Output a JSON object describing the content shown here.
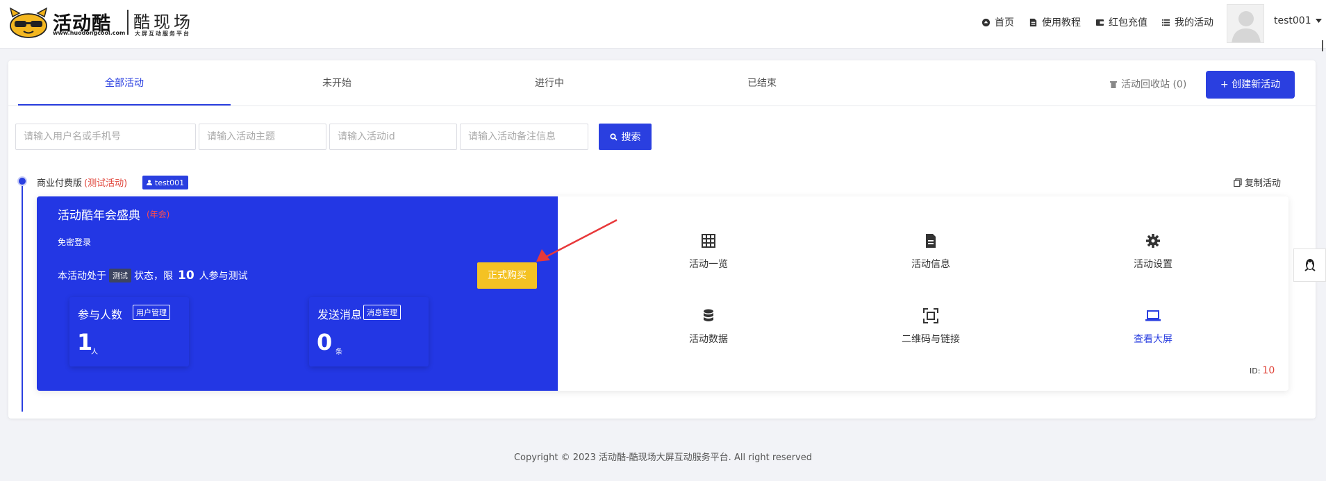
{
  "brand": {
    "name": "活动酷",
    "url": "www.huodongcool.com",
    "sub_title": "酷现场",
    "sub_en": "大屏互动服务平台"
  },
  "nav": {
    "home": "首页",
    "tutorial": "使用教程",
    "recharge": "红包充值",
    "my_activity": "我的活动",
    "username": "test001"
  },
  "tabs": [
    "全部活动",
    "未开始",
    "进行中",
    "已结束"
  ],
  "recycle_bin": "活动回收站 (0)",
  "create_button": "+ 创建新活动",
  "search": {
    "user_placeholder": "请输入用户名或手机号",
    "theme_placeholder": "请输入活动主题",
    "id_placeholder": "请输入活动id",
    "note_placeholder": "请输入活动备注信息",
    "button": "搜索"
  },
  "edition": {
    "label": "商业付费版",
    "test_tag": "(测试活动)",
    "user": "test001",
    "copy": "复制活动"
  },
  "activity": {
    "title": "活动酷年会盛典",
    "tag": "(年会)",
    "free_login": "免密登录",
    "status_prefix": "本活动处于",
    "status_pill": "测试",
    "status_mid": "状态，限",
    "limit": "10",
    "status_suffix": "人参与测试",
    "buy_button": "正式购买",
    "participants": {
      "label": "参与人数",
      "manage": "用户管理",
      "value": "1",
      "unit": "人"
    },
    "messages": {
      "label": "发送消息",
      "manage": "消息管理",
      "value": "0",
      "unit": "条"
    },
    "menu": [
      "活动一览",
      "活动信息",
      "活动设置",
      "活动数据",
      "二维码与链接",
      "查看大屏"
    ],
    "id_label": "ID:",
    "id_value": "10"
  },
  "colors": {
    "primary": "#2a3fe0",
    "card_blue": "#2337e4",
    "buy_yellow": "#f4c223",
    "danger": "#e0443a"
  },
  "footer": "Copyright © 2023 活动酷-酷现场大屏互动服务平台. All right reserved"
}
